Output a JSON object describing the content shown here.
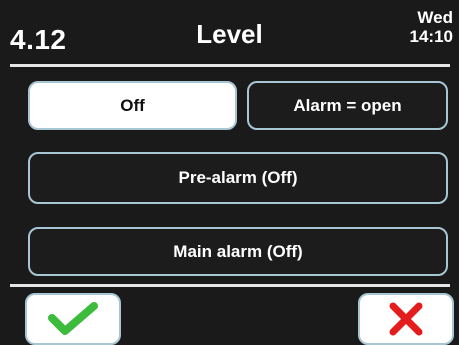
{
  "header": {
    "screen_id": "4.12",
    "title": "Level",
    "day": "Wed",
    "time": "14:10"
  },
  "options": {
    "off_label": "Off",
    "alarm_label": "Alarm = open",
    "prealarm_label": "Pre-alarm (Off)",
    "mainalarm_label": "Main alarm (Off)",
    "selected": "Off"
  },
  "footer": {
    "confirm_icon": "checkmark-icon",
    "cancel_icon": "close-icon"
  },
  "colors": {
    "background": "#1a1a1a",
    "button_border": "#a7c5d2",
    "confirm_green": "#3dbb3d",
    "cancel_red": "#e31d1d"
  }
}
